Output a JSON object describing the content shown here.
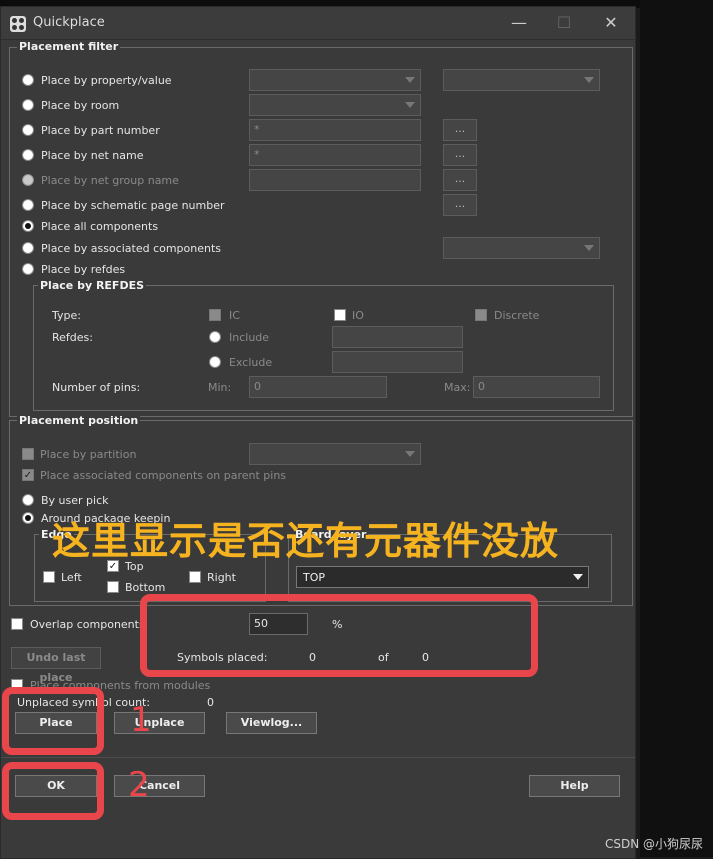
{
  "window": {
    "title": "Quickplace",
    "minimize": "—",
    "maximize": "☐",
    "close": "✕"
  },
  "filter": {
    "group_label": "Placement filter",
    "options": {
      "property": "Place by property/value",
      "room": "Place by room",
      "part_number": "Place by part number",
      "net_name": "Place by net name",
      "net_group": "Place by net group name",
      "schematic_page": "Place by schematic page number",
      "all": "Place all components",
      "associated": "Place by associated components",
      "refdes": "Place by refdes"
    },
    "part_number_value": "*",
    "net_name_value": "*",
    "ellipsis": "...",
    "refdes": {
      "group_label": "Place by REFDES",
      "type_label": "Type:",
      "ic": "IC",
      "io": "IO",
      "discrete": "Discrete",
      "refdes_label": "Refdes:",
      "include": "Include",
      "exclude": "Exclude",
      "pins_label": "Number of pins:",
      "min_label": "Min:",
      "min_value": "0",
      "max_label": "Max:",
      "max_value": "0"
    }
  },
  "position": {
    "group_label": "Placement position",
    "partition": "Place by partition",
    "parent_pins": "Place associated components on parent pins",
    "user_pick": "By user pick",
    "around_package": "Around package keepin",
    "edge_label": "Edge",
    "left": "Left",
    "top": "Top",
    "right": "Right",
    "bottom": "Bottom",
    "board_layer_label": "Board layer",
    "board_layer_value": "TOP"
  },
  "overlap": {
    "label": "Overlap components",
    "value": "50",
    "unit": "%"
  },
  "status": {
    "symbols_placed_label": "Symbols placed:",
    "placed": "0",
    "of_label": "of",
    "total": "0"
  },
  "undo_label": "Undo last place",
  "modules_label": "Place components from modules",
  "unplaced": {
    "label": "Unplaced symbol count:",
    "value": "0"
  },
  "buttons": {
    "place": "Place",
    "unplace": "Unplace",
    "viewlog": "Viewlog...",
    "ok": "OK",
    "cancel": "Cancel",
    "help": "Help"
  },
  "annotations": {
    "overlay_text": "这里显示是否还有元器件没放",
    "num1": "1",
    "num2": "2"
  },
  "watermark": "CSDN @小狗尿尿",
  "colors": {
    "annotation_red": "#e8464b",
    "annotation_yellow": "#f5b320"
  }
}
